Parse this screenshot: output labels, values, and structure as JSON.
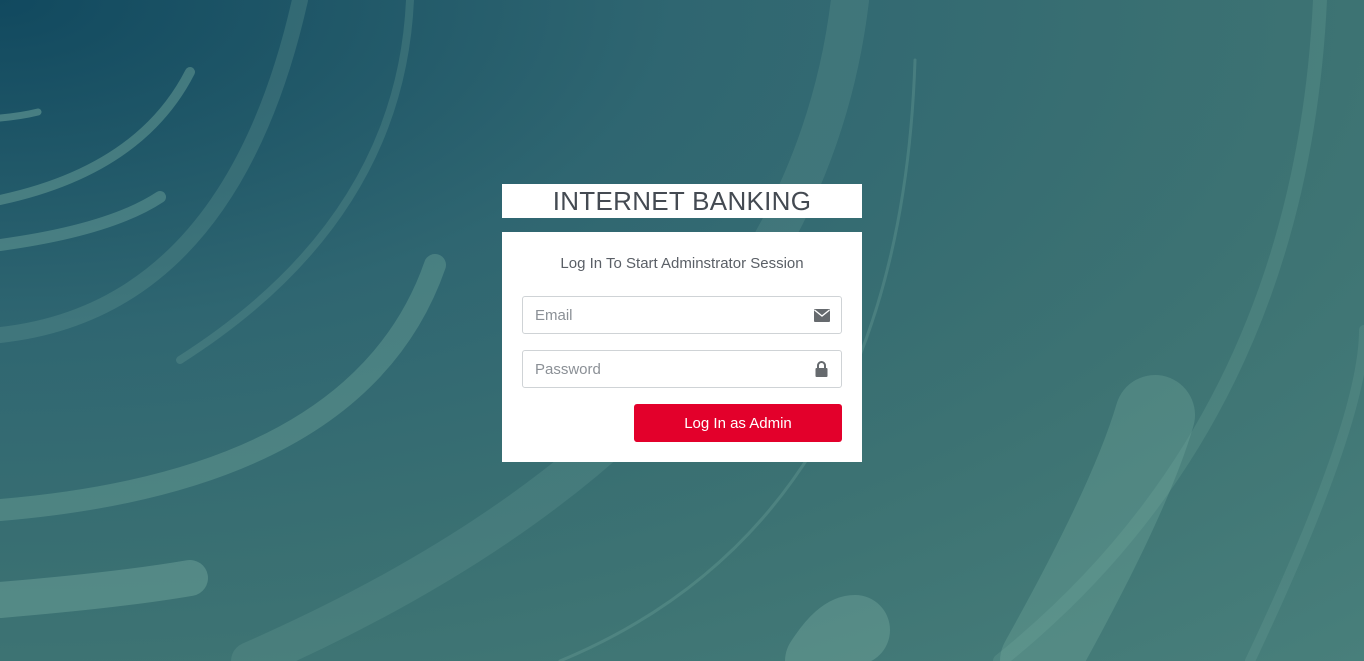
{
  "header": {
    "title": "INTERNET BANKING"
  },
  "login": {
    "message": "Log In To Start Adminstrator Session",
    "email": {
      "placeholder": "Email",
      "value": "",
      "icon": "envelope-icon"
    },
    "password": {
      "placeholder": "Password",
      "value": "",
      "icon": "lock-icon"
    },
    "submit_label": "Log In as Admin"
  },
  "colors": {
    "primary_button": "#e3002b",
    "background": "#3d7373",
    "box": "#ffffff"
  }
}
